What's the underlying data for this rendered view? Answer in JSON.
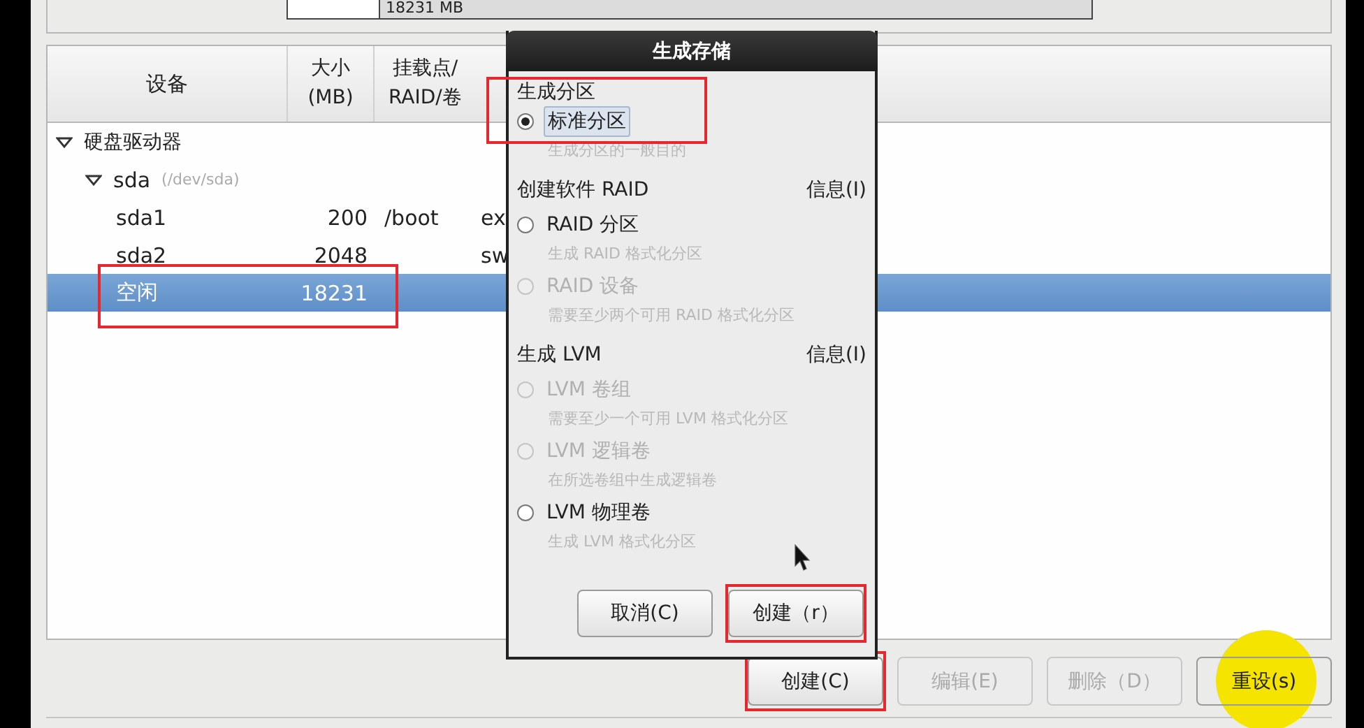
{
  "disk_bar": {
    "free_label": "18231 MB"
  },
  "table": {
    "columns": [
      "设备",
      "大小\n(MB)",
      "挂载点/\nRAID/卷"
    ],
    "rows": [
      {
        "device": "硬盘驱动器",
        "expanded": true,
        "selected": false,
        "children": [
          {
            "device": "sda",
            "path": "(/dev/sda)",
            "expanded": true,
            "selected": false,
            "children": [
              {
                "device": "sda1",
                "size": "200",
                "mount": "/boot",
                "column_4": "ex",
                "selected": false,
                "marked": false
              },
              {
                "device": "sda2",
                "size": "2048",
                "column_4": "sw",
                "selected": false,
                "marked": false
              },
              {
                "device": "空闲",
                "size": "18231",
                "selected": true,
                "marked": true
              }
            ]
          }
        ]
      }
    ]
  },
  "dialog": {
    "title": "生成存储",
    "sections": [
      {
        "heading": "生成分区",
        "options": [
          {
            "label": "标准分区",
            "description": "生成分区的一般目的",
            "selected": true,
            "disabled": false,
            "focused": true,
            "marked": true
          }
        ]
      },
      {
        "heading": "创建软件 RAID",
        "info": "信息(I)",
        "options": [
          {
            "label": "RAID 分区",
            "description": "生成 RAID 格式化分区",
            "selected": false,
            "disabled": false,
            "focused": false,
            "marked": false
          },
          {
            "label": "RAID 设备",
            "description": "需要至少两个可用 RAID 格式化分区",
            "selected": false,
            "disabled": true,
            "focused": false,
            "marked": false
          }
        ]
      },
      {
        "heading": "生成 LVM",
        "info": "信息(I)",
        "options": [
          {
            "label": "LVM 卷组",
            "description": "需要至少一个可用 LVM 格式化分区",
            "selected": false,
            "disabled": true,
            "focused": false,
            "marked": false
          },
          {
            "label": "LVM 逻辑卷",
            "description": "在所选卷组中生成逻辑卷",
            "selected": false,
            "disabled": true,
            "focused": false,
            "marked": false
          },
          {
            "label": "LVM 物理卷",
            "description": "生成 LVM 格式化分区",
            "selected": false,
            "disabled": false,
            "focused": false,
            "marked": false
          }
        ]
      }
    ],
    "buttons": [
      {
        "label": "取消(C)",
        "marked": false
      },
      {
        "label": "创建（r）",
        "marked": true
      }
    ]
  },
  "buttons": [
    {
      "label": "创建(C)",
      "disabled": false,
      "marked": true,
      "highlighted": false
    },
    {
      "label": "编辑(E)",
      "disabled": true,
      "marked": false,
      "highlighted": false
    },
    {
      "label": "删除（D）",
      "disabled": true,
      "marked": false,
      "highlighted": false
    },
    {
      "label": "重设(s)",
      "disabled": false,
      "marked": false,
      "highlighted": true
    }
  ]
}
